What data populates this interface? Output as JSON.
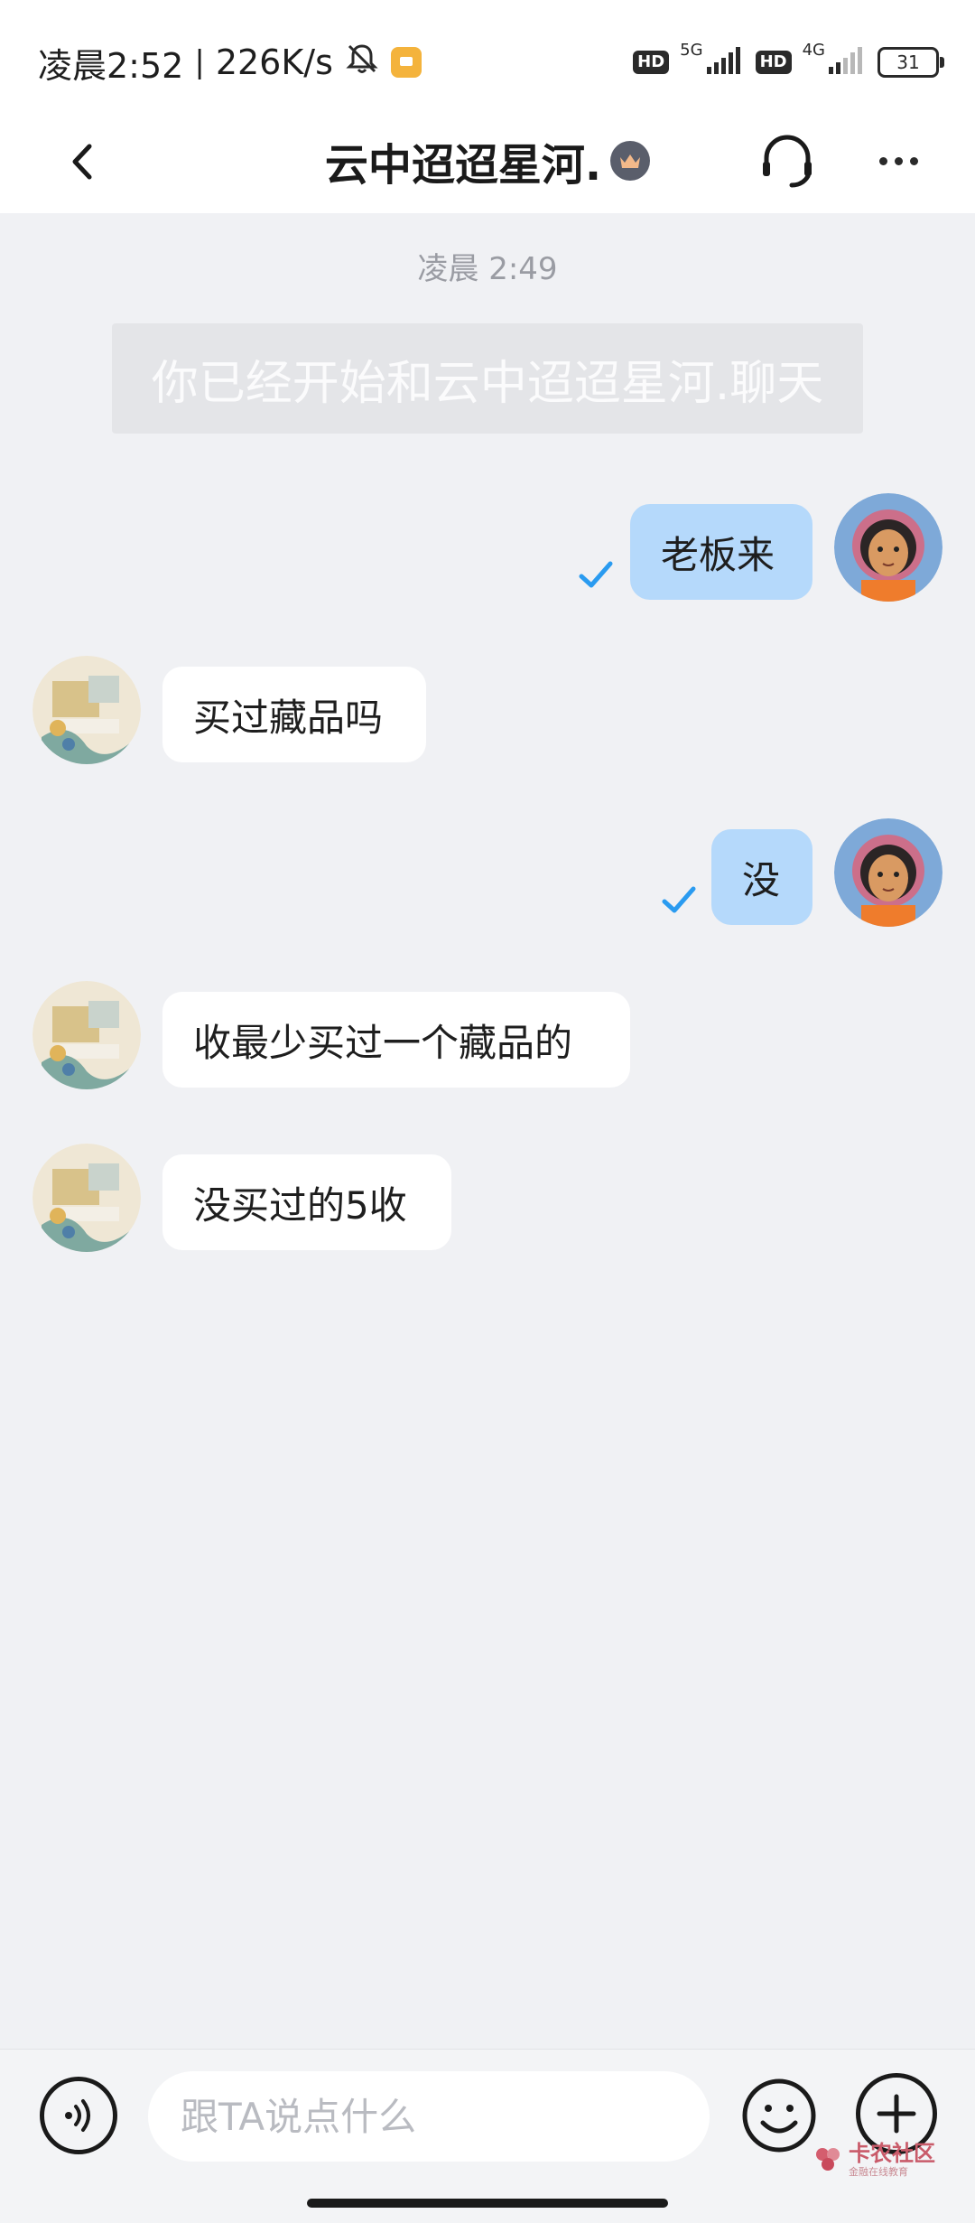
{
  "status_bar": {
    "time": "凌晨2:52",
    "net_speed": "226K/s",
    "network_1": "5G",
    "network_2": "4G",
    "hd_label": "HD",
    "battery": "31"
  },
  "header": {
    "title": "云中迢迢星河.",
    "back_icon": "chevron-left-icon",
    "support_icon": "headset-icon",
    "more_icon": "more-dots-icon"
  },
  "chat": {
    "time_label": "凌晨 2:49",
    "system_notice": "你已经开始和云中迢迢星河.聊天",
    "messages": [
      {
        "direction": "out",
        "text": "老板来",
        "read": true
      },
      {
        "direction": "in",
        "text": "买过藏品吗"
      },
      {
        "direction": "out",
        "text": "没",
        "read": true
      },
      {
        "direction": "in",
        "text": "收最少买过一个藏品的"
      },
      {
        "direction": "in",
        "text": "没买过的5收"
      }
    ]
  },
  "input_bar": {
    "placeholder": "跟TA说点什么",
    "voice_icon": "voice-icon",
    "emoji_icon": "emoji-icon",
    "plus_icon": "plus-icon"
  },
  "watermark": {
    "main": "卡农社区",
    "sub": "金融在线教育"
  },
  "colors": {
    "outgoing_bubble": "#b5d9fb",
    "incoming_bubble": "#ffffff",
    "chat_background": "#f0f1f4",
    "read_check": "#2a9bf0"
  }
}
